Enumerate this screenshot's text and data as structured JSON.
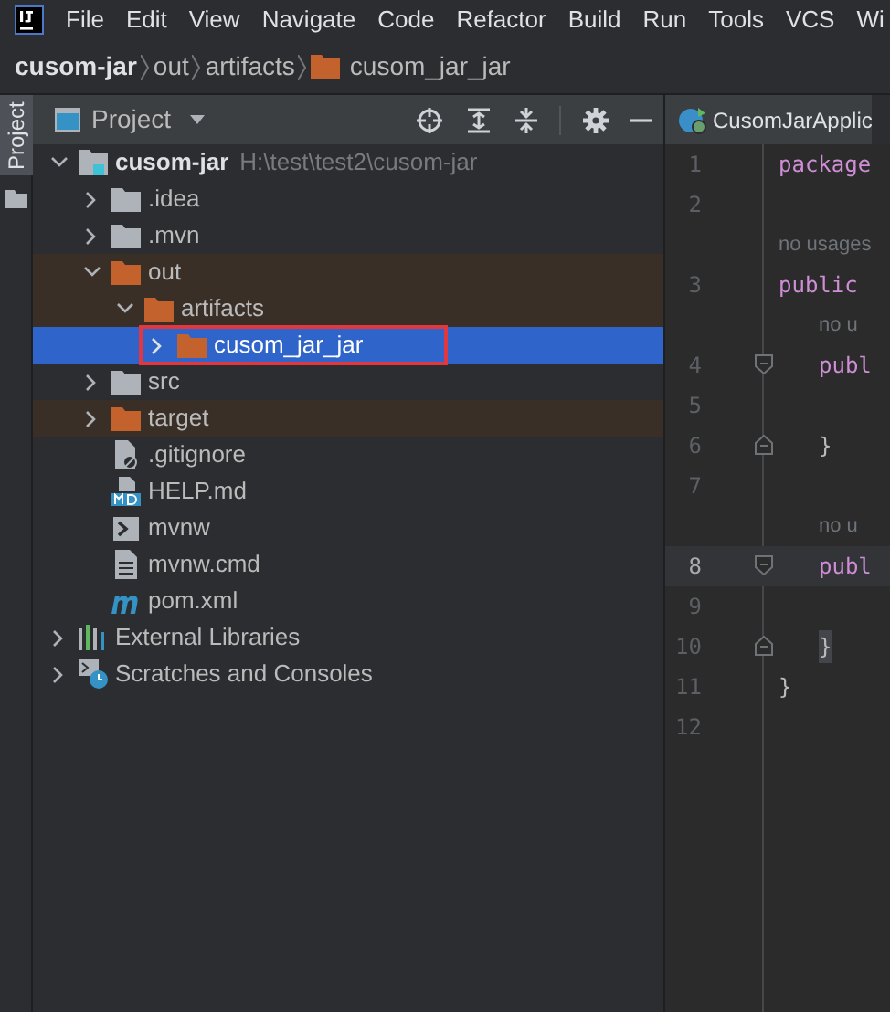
{
  "menu": [
    "File",
    "Edit",
    "View",
    "Navigate",
    "Code",
    "Refactor",
    "Build",
    "Run",
    "Tools",
    "VCS",
    "Wi"
  ],
  "breadcrumb": [
    {
      "label": "cusom-jar",
      "kind": "module"
    },
    {
      "label": "out",
      "kind": "plain"
    },
    {
      "label": "artifacts",
      "kind": "plain"
    },
    {
      "label": "cusom_jar_jar",
      "kind": "folder"
    }
  ],
  "side_stripe": {
    "label": "Project",
    "selected": true
  },
  "project_panel": {
    "title": "Project"
  },
  "tree": [
    {
      "label": "cusom-jar",
      "path": "H:\\test\\test2\\cusom-jar",
      "kind": "module",
      "expanded": true,
      "selected": false,
      "excluded": false,
      "children": [
        {
          "label": ".idea",
          "kind": "folder",
          "expanded": false,
          "selected": false,
          "excluded": false
        },
        {
          "label": ".mvn",
          "kind": "folder",
          "expanded": false,
          "selected": false,
          "excluded": false
        },
        {
          "label": "out",
          "kind": "folder",
          "expanded": true,
          "selected": false,
          "excluded": true,
          "children": [
            {
              "label": "artifacts",
              "kind": "folder",
              "expanded": true,
              "selected": false,
              "excluded": true,
              "children": [
                {
                  "label": "cusom_jar_jar",
                  "kind": "folder",
                  "expanded": false,
                  "selected": true,
                  "excluded": true,
                  "outlined": true
                }
              ]
            }
          ]
        },
        {
          "label": "src",
          "kind": "folder",
          "expanded": false,
          "selected": false,
          "excluded": false
        },
        {
          "label": "target",
          "kind": "folder",
          "expanded": false,
          "selected": false,
          "excluded": true
        },
        {
          "label": ".gitignore",
          "kind": "ignored",
          "selected": false,
          "excluded": false
        },
        {
          "label": "HELP.md",
          "kind": "markdown",
          "selected": false,
          "excluded": false
        },
        {
          "label": "mvnw",
          "kind": "shell",
          "selected": false,
          "excluded": false
        },
        {
          "label": "mvnw.cmd",
          "kind": "text",
          "selected": false,
          "excluded": false
        },
        {
          "label": "pom.xml",
          "kind": "maven",
          "selected": false,
          "excluded": false
        }
      ]
    },
    {
      "label": "External Libraries",
      "kind": "libraries",
      "expanded": false,
      "selected": false,
      "excluded": false
    },
    {
      "label": "Scratches and Consoles",
      "kind": "scratches",
      "expanded": false,
      "selected": false,
      "excluded": false
    }
  ],
  "editor": {
    "tab": "CusomJarApplic",
    "lines": [
      {
        "kind": "code",
        "number": "1",
        "text": "package",
        "current": false
      },
      {
        "kind": "code",
        "number": "2",
        "current": false
      },
      {
        "kind": "hint",
        "text": "no usages"
      },
      {
        "kind": "code",
        "number": "3",
        "text": "public",
        "current": false
      },
      {
        "kind": "member-hint",
        "text": "no u"
      },
      {
        "kind": "fold-start",
        "number": "4",
        "text": "publ",
        "current": false
      },
      {
        "kind": "code",
        "number": "5",
        "current": false
      },
      {
        "kind": "fold-end",
        "number": "6",
        "text": "}",
        "current": false
      },
      {
        "kind": "code",
        "number": "7",
        "current": false
      },
      {
        "kind": "member-hint",
        "text": "no u"
      },
      {
        "kind": "fold-start",
        "number": "8",
        "text": "publ",
        "current": true
      },
      {
        "kind": "code",
        "number": "9",
        "current": false
      },
      {
        "kind": "fold-end",
        "number": "10",
        "text": "}",
        "current": false,
        "matched": true
      },
      {
        "kind": "code",
        "number": "11",
        "text": "}",
        "current": false
      },
      {
        "kind": "code",
        "number": "12",
        "current": false
      }
    ]
  }
}
